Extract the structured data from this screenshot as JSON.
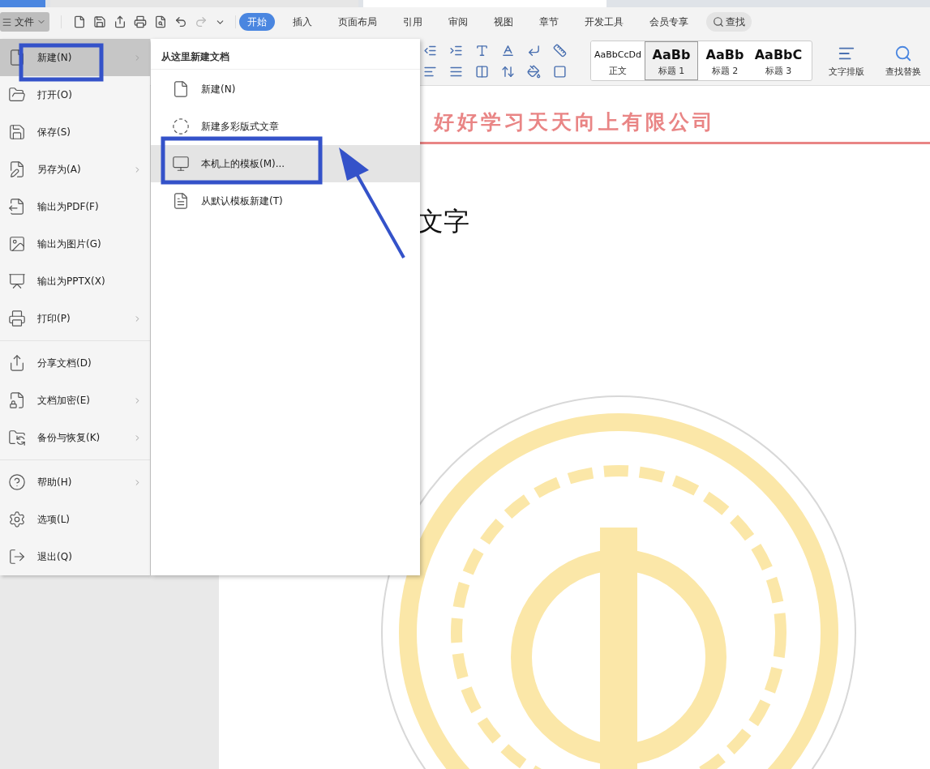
{
  "toolbar": {
    "file_menu": "文件",
    "tabs": [
      {
        "label": "开始",
        "selected": true
      },
      {
        "label": "插入",
        "selected": false
      },
      {
        "label": "页面布局",
        "selected": false
      },
      {
        "label": "引用",
        "selected": false
      },
      {
        "label": "审阅",
        "selected": false
      },
      {
        "label": "视图",
        "selected": false
      },
      {
        "label": "章节",
        "selected": false
      },
      {
        "label": "开发工具",
        "selected": false
      },
      {
        "label": "会员专享",
        "selected": false
      }
    ],
    "search": "查找"
  },
  "ribbon": {
    "styles": [
      {
        "preview": "AaBbCcDd",
        "label": "正文",
        "kind": "body",
        "selected": false
      },
      {
        "preview": "AaBb",
        "label": "标题 1",
        "kind": "heading",
        "selected": true
      },
      {
        "preview": "AaBb",
        "label": "标题 2",
        "kind": "heading",
        "selected": false
      },
      {
        "preview": "AaBbC",
        "label": "标题 3",
        "kind": "heading",
        "selected": false
      }
    ],
    "buttons": [
      {
        "label": "文字排版"
      },
      {
        "label": "查找替换"
      }
    ]
  },
  "file_menu": {
    "groups": [
      [
        {
          "label": "新建(N)",
          "has_submenu": true,
          "selected": true
        },
        {
          "label": "打开(O)",
          "has_submenu": false,
          "selected": false
        },
        {
          "label": "保存(S)",
          "has_submenu": false,
          "selected": false
        },
        {
          "label": "另存为(A)",
          "has_submenu": true,
          "selected": false
        },
        {
          "label": "输出为PDF(F)",
          "has_submenu": false,
          "selected": false
        },
        {
          "label": "输出为图片(G)",
          "has_submenu": false,
          "selected": false
        },
        {
          "label": "输出为PPTX(X)",
          "has_submenu": false,
          "selected": false
        },
        {
          "label": "打印(P)",
          "has_submenu": true,
          "selected": false
        }
      ],
      [
        {
          "label": "分享文档(D)",
          "has_submenu": false,
          "selected": false
        },
        {
          "label": "文档加密(E)",
          "has_submenu": true,
          "selected": false
        },
        {
          "label": "备份与恢复(K)",
          "has_submenu": true,
          "selected": false
        }
      ],
      [
        {
          "label": "帮助(H)",
          "has_submenu": true,
          "selected": false
        },
        {
          "label": "选项(L)",
          "has_submenu": false,
          "selected": false
        },
        {
          "label": "退出(Q)",
          "has_submenu": false,
          "selected": false
        }
      ]
    ]
  },
  "submenu": {
    "title": "从这里新建文档",
    "items": [
      {
        "label": "新建(N)",
        "selected": false
      },
      {
        "label": "新建多彩版式文章",
        "selected": false
      },
      {
        "label": "本机上的模板(M)...",
        "selected": true
      },
      {
        "label": "从默认模板新建(T)",
        "selected": false
      }
    ]
  },
  "document": {
    "header": "好好学习天天向上有限公司",
    "body_text": "文字"
  }
}
